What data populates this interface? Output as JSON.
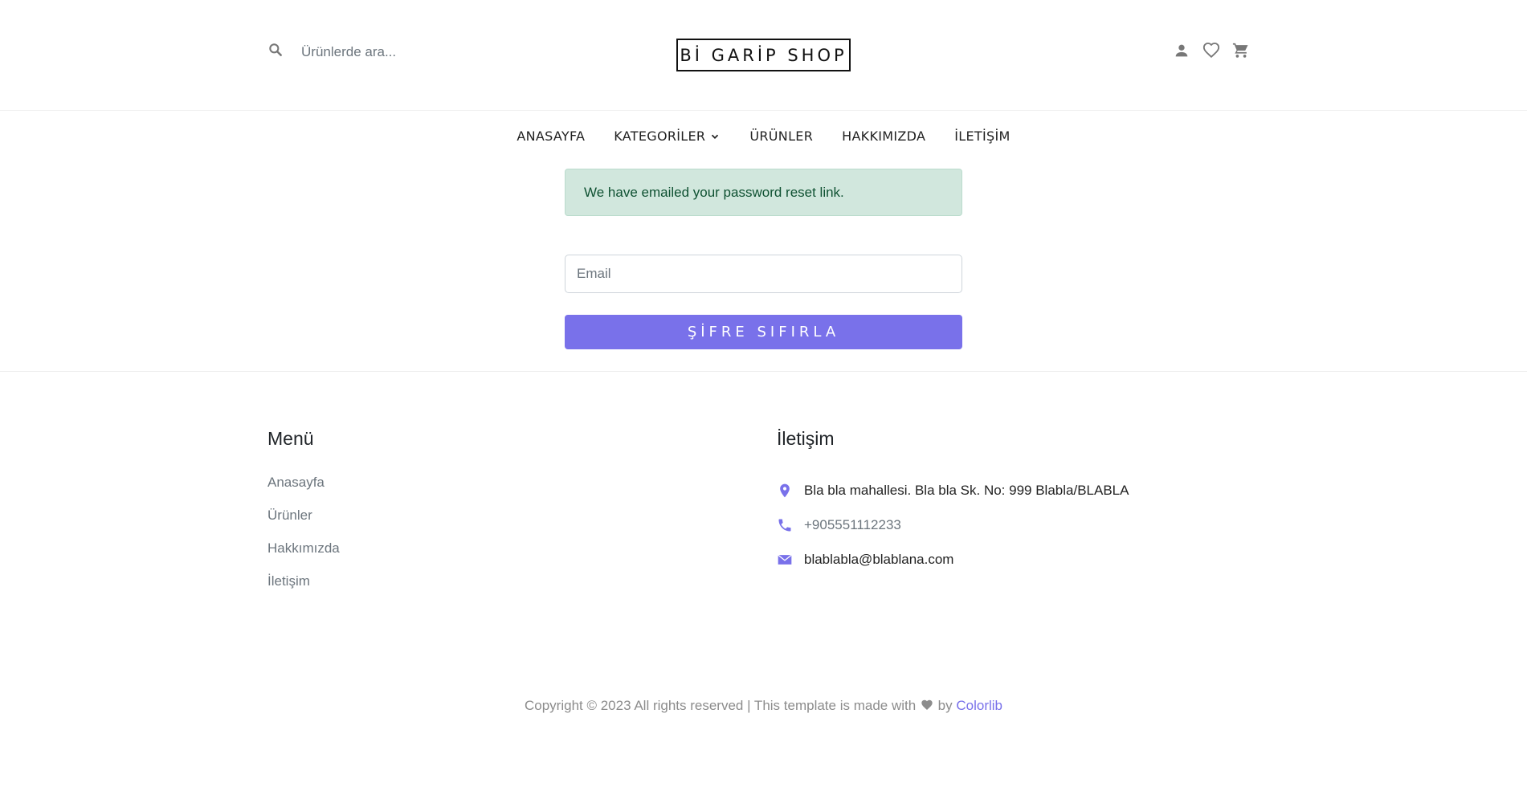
{
  "header": {
    "search_placeholder": "Ürünlerde ara...",
    "logo": "Bİ GARİP SHOP",
    "icons": [
      "user-icon",
      "heart-icon",
      "cart-icon"
    ]
  },
  "nav": {
    "items": [
      "ANASAYFA",
      "KATEGORİLER",
      "ÜRÜNLER",
      "HAKKIMIZDA",
      "İLETİŞİM"
    ]
  },
  "alert": {
    "message": "We have emailed your password reset link."
  },
  "form": {
    "email_placeholder": "Email",
    "email_value": "",
    "submit_label": "ŞİFRE SIFIRLA"
  },
  "footer": {
    "menu_title": "Menü",
    "menu_links": [
      "Anasayfa",
      "Ürünler",
      "Hakkımızda",
      "İletişim"
    ],
    "contact_title": "İletişim",
    "address": "Bla bla mahallesi. Bla bla Sk. No: 999 Blabla/BLABLA",
    "phone": "+905551112233",
    "email": "blablabla@blablana.com",
    "copyright_prefix": "Copyright © 2023 All rights reserved | This template is made with",
    "copyright_by": "by",
    "copyright_brand": "Colorlib"
  },
  "colors": {
    "accent": "#7971ea",
    "alert_bg": "#d1e7dd",
    "alert_text": "#0f5132"
  }
}
